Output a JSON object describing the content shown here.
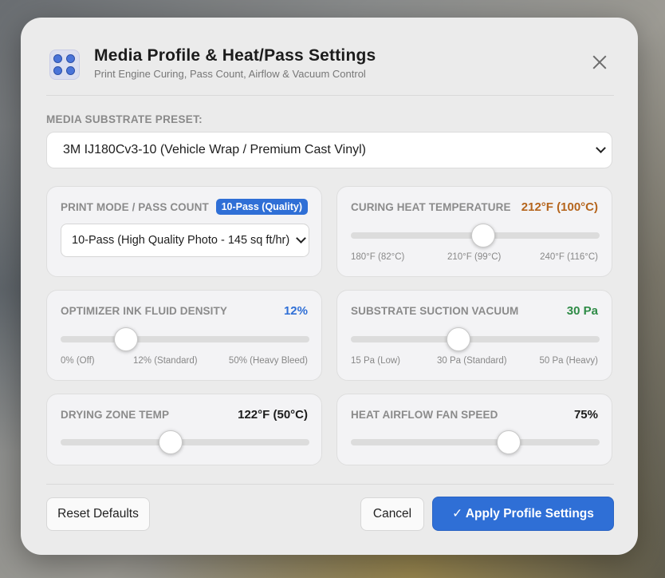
{
  "dialog": {
    "title": "Media Profile & Heat/Pass Settings",
    "subtitle": "Print Engine Curing, Pass Count, Airflow & Vacuum Control",
    "app_icon": "media-settings-icon",
    "close_icon": "close-icon"
  },
  "preset": {
    "label": "MEDIA SUBSTRATE PRESET:",
    "selected": "3M IJ180Cv3-10 (Vehicle Wrap / Premium Cast Vinyl)"
  },
  "print_mode": {
    "label": "PRINT MODE / PASS COUNT",
    "badge": "10-Pass (Quality)",
    "selected": "10-Pass (High Quality Photo - 145 sq ft/hr)"
  },
  "curing_heat": {
    "label": "CURING HEAT TEMPERATURE",
    "value": "212°F (100°C)",
    "fraction": 0.53,
    "ticks": [
      "180°F (82°C)",
      "210°F (99°C)",
      "240°F (116°C)"
    ],
    "color": "#b5651d"
  },
  "ink_density": {
    "label": "OPTIMIZER INK FLUID DENSITY",
    "value": "12%",
    "fraction": 0.26,
    "ticks": [
      "0% (Off)",
      "12% (Standard)",
      "50% (Heavy Bleed)"
    ],
    "color": "#2f6fd6"
  },
  "vacuum": {
    "label": "SUBSTRATE SUCTION VACUUM",
    "value": "30 Pa",
    "fraction": 0.43,
    "ticks": [
      "15 Pa (Low)",
      "30 Pa (Standard)",
      "50 Pa (Heavy)"
    ],
    "color": "#2e8b46"
  },
  "drying_zone": {
    "label": "DRYING ZONE TEMP",
    "value": "122°F (50°C)",
    "fraction": 0.44,
    "color": "#1c1c1c"
  },
  "airflow": {
    "label": "HEAT AIRFLOW FAN SPEED",
    "value": "75%",
    "fraction": 0.63,
    "color": "#1c1c1c"
  },
  "footer": {
    "reset": "Reset Defaults",
    "cancel": "Cancel",
    "apply": "✓ Apply Profile Settings"
  }
}
